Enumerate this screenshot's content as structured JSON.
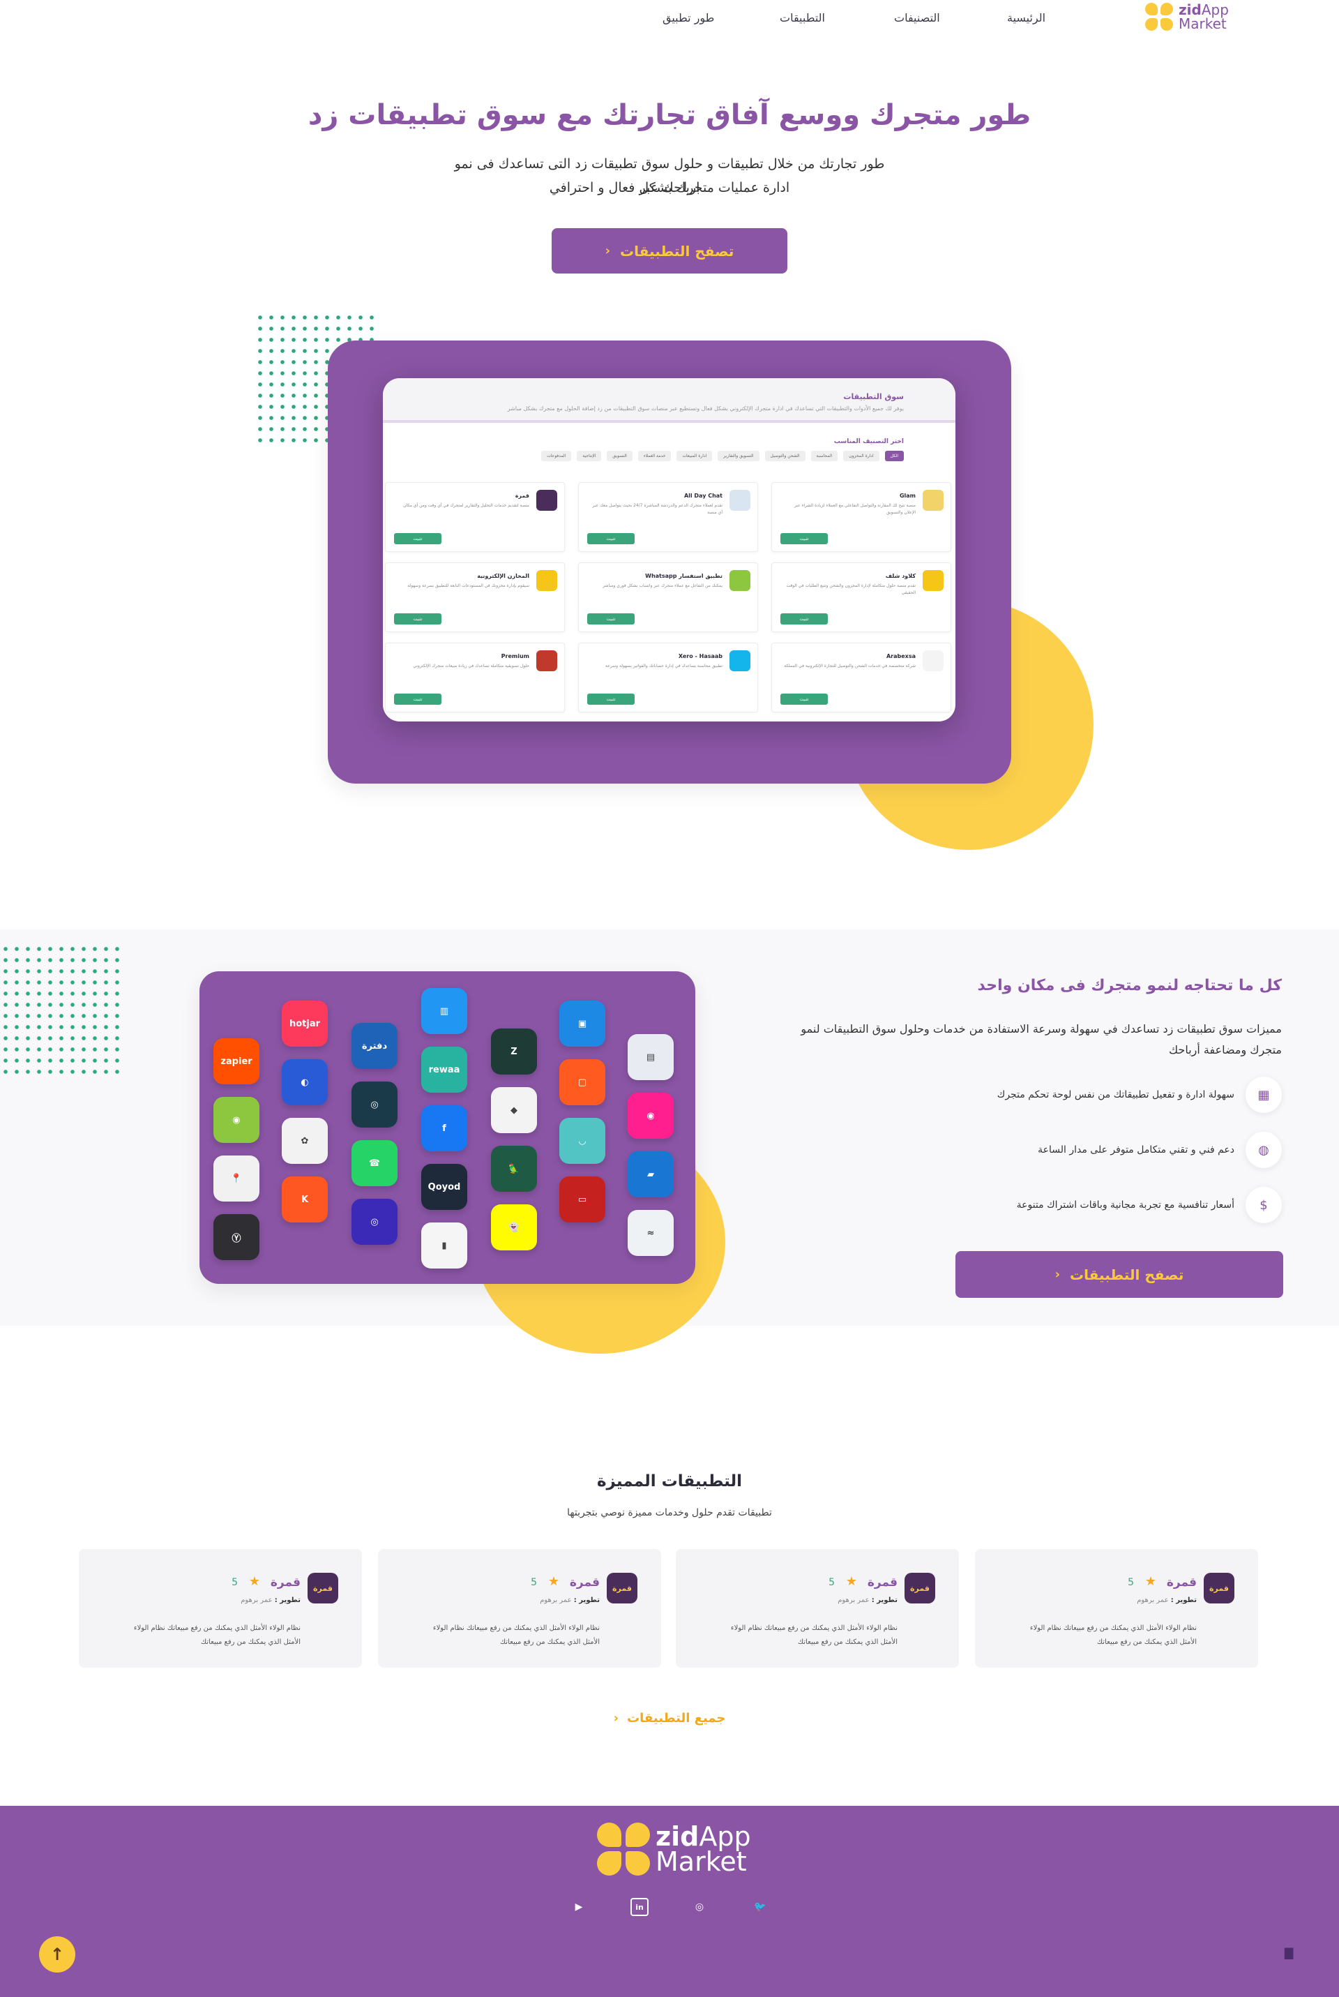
{
  "header": {
    "logo_bold": "zid",
    "logo_rest": "App",
    "logo_line2": "Market",
    "nav": [
      "الرئيسية",
      "التصنيفات",
      "التطبيقات",
      "طور تطبيق"
    ]
  },
  "hero": {
    "title": "طور متجرك ووسع آفاق تجارتك مع سوق تطبيقات زد",
    "subtitle_line1": "طور تجارتك من خلال تطبيقات و حلول سوق تطبيقات زد التى تساعدك فى نمو ارباحك عبر",
    "subtitle_line2": "ادارة عمليات متجرك بشكل فعال و احترافي",
    "button": "تصفح التطبيقات"
  },
  "mockup": {
    "title": "سوق التطبيقات",
    "subtitle": "يوفر لك جميع الأدوات والتطبيقات التي تساعدك في ادارة متجرك الإلكتروني بشكل فعال وتستطيع عبر منصات سوق التطبيقات من زد إضافة الحلول مع متجرك بشكل مباشر",
    "filter_title": "اختر التصنيف المناسب",
    "chips": [
      "الكل",
      "ادارة المخزون",
      "المحاسبة",
      "الشحن والتوصيل",
      "التسويق والتقارير",
      "ادارة المبيعات",
      "خدمة العملاء",
      "التسويق",
      "الإنتاجية",
      "المدفوعات"
    ],
    "install_label": "تثبيت",
    "cards": [
      {
        "name": "Glam",
        "desc": "منصة تتيح لك المقارنة والتواصل التفاعلي مع العملاء لزيادة الشراء عبر الإعلان والتسويق",
        "color": "#f1d36a"
      },
      {
        "name": "All Day Chat",
        "desc": "تقدم لعملاء متجرك الدعم والدردشة المباشرة 24/7 بحيث يتواصل معك عبر أي منصة",
        "color": "#d9e6f2"
      },
      {
        "name": "قمرة",
        "desc": "منصة لتقديم خدمات التحليل والتقارير لمتجرك في أي وقت ومن أي مكان",
        "color": "#4a2d5a"
      },
      {
        "name": "كلاود شلف",
        "desc": "تقدم منصة حلول متكاملة لإدارة المخزون والشحن وتتبع الطلبات في الوقت الحقيقي",
        "color": "#f5c518"
      },
      {
        "name": "تطبيق استفسار Whatsapp",
        "desc": "يمكنك من التفاعل مع عملاء متجرك عبر واتساب بشكل فوري ومباشر",
        "color": "#8dc63f"
      },
      {
        "name": "المخازن الإلكترونية",
        "desc": "سيقوم بإدارة مخزونك في المستودعات التابعة للتطبيق بسرعة وسهولة",
        "color": "#f5c518"
      },
      {
        "name": "Arabexsa",
        "desc": "شركة متخصصة في خدمات الشحن والتوصيل للتجارة الإلكترونية في المملكة",
        "color": "#f4f4f4"
      },
      {
        "name": "Xero - Hasaab",
        "desc": "تطبيق محاسبة يساعدك في إدارة حساباتك والفواتير بسهولة وسرعة",
        "color": "#13b5ea"
      },
      {
        "name": "Premium",
        "desc": "حلول تسويقية متكاملة تساعدك في زيادة مبيعات متجرك الإلكتروني",
        "color": "#c0392b"
      }
    ]
  },
  "section2": {
    "title": "كل ما تحتاجه لنمو متجرك فى مكان واحد",
    "subtitle_line1": "مميزات سوق تطبيقات زد تساعدك في سهولة وسرعة الاستفادة من خدمات وحلول سوق التطبيقات لنمو",
    "subtitle_line2": "متجرك ومضاعفة أرباحك",
    "features": [
      {
        "text": "سهولة ادارة و تفعيل تطبيقاتك من نفس لوحة تحكم متجرك",
        "icon": "dashboard-icon"
      },
      {
        "text": "دعم فني و تقني متكامل متوفر على مدار الساعة",
        "icon": "support-icon"
      },
      {
        "text": "أسعار تنافسية مع تجربة مجانية وباقات اشتراك متنوعة",
        "icon": "price-tag-icon"
      }
    ],
    "button": "تصفح التطبيقات",
    "apps": [
      {
        "label": "zapier",
        "color": "#ff4f00"
      },
      {
        "label": "◉",
        "color": "#8dc63f"
      },
      {
        "label": "📍",
        "color": "#f1f1f1"
      },
      {
        "label": "Ⓨ",
        "color": "#2f2f33"
      },
      {
        "label": "hotjar",
        "color": "#fd3a5c"
      },
      {
        "label": "◐",
        "color": "#2a5bd7"
      },
      {
        "label": "✿",
        "color": "#f2f2f2"
      },
      {
        "label": "K",
        "color": "#ff5722"
      },
      {
        "label": "دفترة",
        "color": "#1e63b8"
      },
      {
        "label": "◎",
        "color": "#1a3a4a"
      },
      {
        "label": "☎",
        "color": "#25d366"
      },
      {
        "label": "◎",
        "color": "#3b2ab8"
      },
      {
        "label": "▥",
        "color": "#2196f3"
      },
      {
        "label": "rewaa",
        "color": "#27b3a0"
      },
      {
        "label": "f",
        "color": "#1877f2"
      },
      {
        "label": "Qoyod",
        "color": "#1e2a3a"
      },
      {
        "label": "▮",
        "color": "#f5f5f5"
      },
      {
        "label": "Z",
        "color": "#1f3b35"
      },
      {
        "label": "◆",
        "color": "#f3f3f3"
      },
      {
        "label": "🦜",
        "color": "#1f5a44"
      },
      {
        "label": "👻",
        "color": "#fffc00"
      },
      {
        "label": "▣",
        "color": "#1e88e5"
      },
      {
        "label": "▢",
        "color": "#ff5a1f"
      },
      {
        "label": "◡",
        "color": "#52c4c4"
      },
      {
        "label": "▭",
        "color": "#c5221f"
      },
      {
        "label": "▤",
        "color": "#e8ecf2"
      },
      {
        "label": "◉",
        "color": "#ff1f8e"
      },
      {
        "label": "▰",
        "color": "#1976d2"
      },
      {
        "label": "≈",
        "color": "#eef2f4"
      }
    ]
  },
  "featured": {
    "title": "التطبيقات المميزة",
    "subtitle": "تطبيقات تقدم حلول وخدمات مميزة نوصي بتجربتها",
    "cards": [
      {
        "logo": "قمرة",
        "name": "قمرة",
        "rating": "5",
        "dev_label": "تطوير :",
        "dev": "عمر برهوم",
        "desc": "نظام الولاء الأمثل الذي يمكنك من رفع مبيعاتك نظام الولاء الأمثل الذي يمكنك من رفع مبيعاتك"
      },
      {
        "logo": "قمرة",
        "name": "قمرة",
        "rating": "5",
        "dev_label": "تطوير :",
        "dev": "عمر برهوم",
        "desc": "نظام الولاء الأمثل الذي يمكنك من رفع مبيعاتك نظام الولاء الأمثل الذي يمكنك من رفع مبيعاتك"
      },
      {
        "logo": "قمرة",
        "name": "قمرة",
        "rating": "5",
        "dev_label": "تطوير :",
        "dev": "عمر برهوم",
        "desc": "نظام الولاء الأمثل الذي يمكنك من رفع مبيعاتك نظام الولاء الأمثل الذي يمكنك من رفع مبيعاتك"
      },
      {
        "logo": "قمرة",
        "name": "قمرة",
        "rating": "5",
        "dev_label": "تطوير :",
        "dev": "عمر برهوم",
        "desc": "نظام الولاء الأمثل الذي يمكنك من رفع مبيعاتك نظام الولاء الأمثل الذي يمكنك من رفع مبيعاتك"
      }
    ],
    "all_link": "جميع التطبيقات"
  },
  "footer": {
    "logo_bold": "zid",
    "logo_rest": "App",
    "logo_line2": "Market",
    "socials": [
      {
        "label": "▶",
        "icon": "youtube-icon"
      },
      {
        "label": "in",
        "icon": "linkedin-icon"
      },
      {
        "label": "◎",
        "icon": "instagram-icon"
      },
      {
        "label": "🐦",
        "icon": "twitter-icon"
      }
    ],
    "top_button": "↑",
    "chat_icon": "▇"
  },
  "colors": {
    "brand": "#8a55a5",
    "accent": "#fbc93c",
    "green": "#3aa57a"
  }
}
